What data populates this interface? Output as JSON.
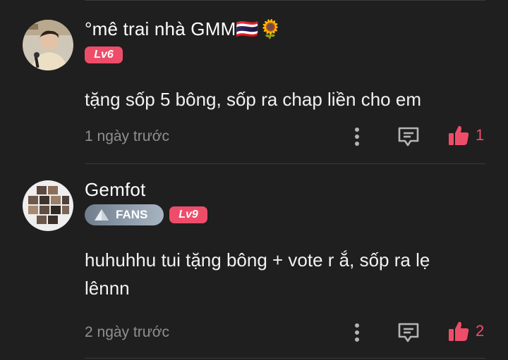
{
  "comments": [
    {
      "username": "°mê trai nhà GMM🇹🇭🌻",
      "level": "Lv6",
      "body": "tặng sốp 5 bông, sốp ra chap liền cho em",
      "timestamp": "1 ngày trước",
      "likes": "1"
    },
    {
      "username": "Gemfot",
      "fans_badge": "FANS",
      "level": "Lv9",
      "body": "huhuhhu tui tặng bông + vote r ắ, sốp ra lẹ lênnn",
      "timestamp": "2 ngày trước",
      "likes": "2"
    }
  ],
  "colors": {
    "background": "#1f1f1f",
    "accent": "#ee4d6a",
    "muted_text": "#8f8f8f",
    "icon": "#b5b5b5"
  },
  "icons": [
    "avatar-photo",
    "more-vertical-icon",
    "reply-icon",
    "thumbs-up-icon",
    "triangle-icon"
  ]
}
